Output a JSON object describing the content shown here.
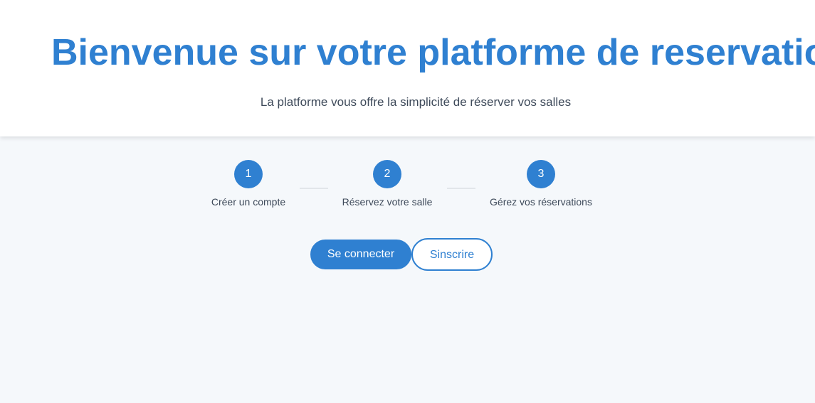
{
  "hero": {
    "title": "Bienvenue sur votre platforme de reservation",
    "subtitle": "La platforme vous offre la simplicité de réserver vos salles"
  },
  "steps": [
    {
      "number": "1",
      "label": "Créer un compte"
    },
    {
      "number": "2",
      "label": "Réservez votre salle"
    },
    {
      "number": "3",
      "label": "Gérez vos réservations"
    }
  ],
  "actions": {
    "login_label": "Se connecter",
    "signup_label": "Sinscrire"
  },
  "colors": {
    "accent": "#2f80d1",
    "background": "#f5f8fb",
    "text": "#3e4a5a"
  }
}
